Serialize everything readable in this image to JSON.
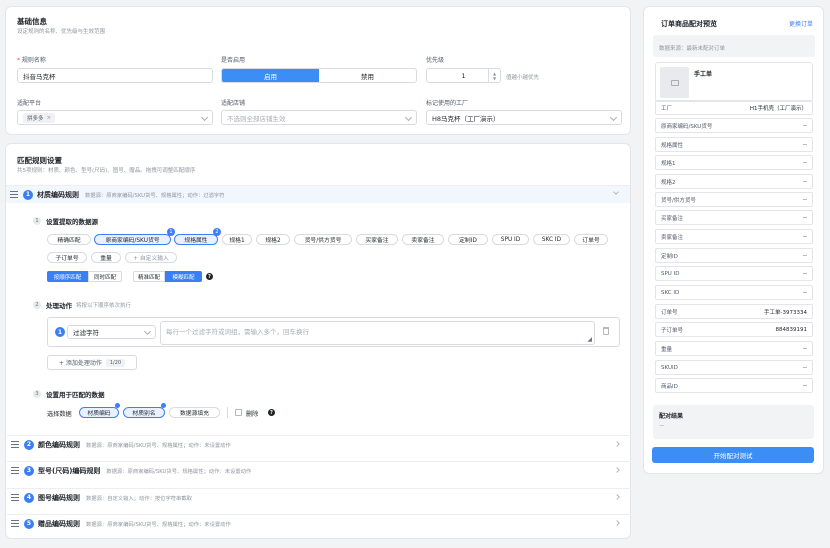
{
  "basic": {
    "title": "基础信息",
    "subtitle": "设定规则的名称、优先级与生效范围",
    "rule_name_label": "规则名称",
    "rule_name_value": "抖音马克杯",
    "enabled_label": "是否启用",
    "enabled_on": "启用",
    "enabled_off": "禁用",
    "priority_label": "优先级",
    "priority_value": "1",
    "priority_hint": "值越小越优先",
    "platform_label": "适配平台",
    "platform_tag": "拼多多",
    "shop_label": "适配店铺",
    "shop_placeholder": "不选则全部店铺生效",
    "factory_label": "标记使用的工厂",
    "factory_value": "H8马克杯（工厂演示）"
  },
  "match": {
    "title": "匹配规则设置",
    "subtitle": "共5项规则：材质、颜色、型号(尺码)、图号、赠品。拖拽可调整匹配顺序"
  },
  "rules": [
    {
      "num": "1",
      "name": "材质编码规则",
      "desc": "数据源：原商家编码/SKU货号、规格属性；动作：过滤字符"
    },
    {
      "num": "2",
      "name": "颜色编码规则",
      "desc": "数据源：原商家编码/SKU货号、规格属性；动作：未设置动作"
    },
    {
      "num": "3",
      "name": "型号(尺码)编码规则",
      "desc": "数据源：原商家编码/SKU货号、规格属性；动作：未设置动作"
    },
    {
      "num": "4",
      "name": "图号编码规则",
      "desc": "数据源：自定义输入；动作：按位字符串截取"
    },
    {
      "num": "5",
      "name": "赠品编码规则",
      "desc": "数据源：原商家编码/SKU货号、规格属性；动作：未设置动作"
    }
  ],
  "step1": {
    "num": "1",
    "title": "设置提取的数据源",
    "chips": [
      "精确匹配",
      "原商家编码/SKU货号",
      "规格属性",
      "规格1",
      "规格2",
      "货号/供方货号",
      "买家备注",
      "卖家备注",
      "定制ID",
      "SPU ID",
      "SKC ID",
      "订单号",
      "子订单号",
      "重量",
      "+ 自定义输入"
    ],
    "badge1": "1",
    "badge2": "2",
    "btn_order_match": "按顺序匹配",
    "btn_simul_match": "同时匹配",
    "btn_exact_match": "精准匹配",
    "btn_fuzzy_match": "模糊匹配",
    "help": "?"
  },
  "step2": {
    "num": "2",
    "title": "处理动作",
    "hint": "将按以下顺序依次执行",
    "action_num": "1",
    "action_select": "过滤字符",
    "action_placeholder": "每行一个过滤字符或词组，需输入多个，回车换行",
    "add_label": "+ 添加处理动作",
    "add_count": "1/20"
  },
  "step3": {
    "num": "3",
    "title": "设置用于匹配的数据",
    "select_label": "选择数据",
    "chip_material": "材质编码",
    "chip_material_name": "材质别名",
    "chip_db": "数据源填充",
    "delete_label": "删除",
    "help": "?"
  },
  "preview": {
    "title": "订单商品配对预览",
    "switch": "更换订单",
    "source": "数据来源：最新未配对订单",
    "item_name": "手工单",
    "rows": [
      {
        "k": "工厂",
        "v": "H1手机壳（工厂演示）"
      },
      {
        "k": "原商家编码/SKU货号",
        "v": "--"
      },
      {
        "k": "规格属性",
        "v": "--"
      },
      {
        "k": "规格1",
        "v": "--"
      },
      {
        "k": "规格2",
        "v": "--"
      },
      {
        "k": "货号/供方货号",
        "v": "--"
      },
      {
        "k": "买家备注",
        "v": "--"
      },
      {
        "k": "卖家备注",
        "v": "--"
      },
      {
        "k": "定制ID",
        "v": "--"
      },
      {
        "k": "SPU ID",
        "v": "--"
      },
      {
        "k": "SKC ID",
        "v": "--"
      },
      {
        "k": "订单号",
        "v": "手工单-3973334"
      },
      {
        "k": "子订单号",
        "v": "884839191"
      },
      {
        "k": "重量",
        "v": "--"
      },
      {
        "k": "SKUID",
        "v": "--"
      },
      {
        "k": "商品ID",
        "v": "--"
      }
    ],
    "result_label": "配对结果",
    "result_value": "—",
    "test_button": "开始配对测试"
  },
  "colors": {
    "accent": "#3b7ff6",
    "required": "#f53f3f"
  }
}
